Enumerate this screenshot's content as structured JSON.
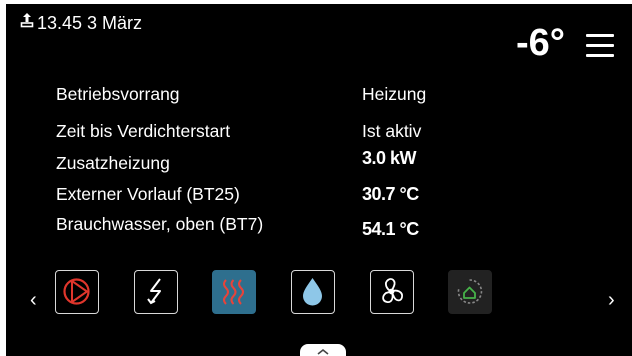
{
  "status": {
    "text": "13.45 3 März",
    "icon": "upload-icon"
  },
  "header": {
    "temperature": "-6°",
    "menu_icon": "hamburger-menu-icon"
  },
  "info_rows": [
    {
      "label": "Betriebsvorrang",
      "value": "Heizung"
    },
    {
      "label": "Zeit bis Verdichterstart",
      "value": "Ist aktiv"
    },
    {
      "label": "Zusatzheizung",
      "value": "3.0 kW"
    },
    {
      "label": "Externer Vorlauf (BT25)",
      "value": "30.7 °C"
    },
    {
      "label": "Brauchwasser, oben (BT7)",
      "value": "54.1 °C"
    }
  ],
  "carousel": {
    "prev_icon": "chevron-left-icon",
    "next_icon": "chevron-right-icon",
    "tiles": [
      {
        "icon": "compressor-icon",
        "state": "normal"
      },
      {
        "icon": "electric-heater-icon",
        "state": "normal"
      },
      {
        "icon": "heating-icon",
        "state": "active"
      },
      {
        "icon": "hot-water-icon",
        "state": "normal"
      },
      {
        "icon": "fan-icon",
        "state": "normal"
      },
      {
        "icon": "house-cycle-icon",
        "state": "disabled"
      }
    ]
  },
  "colors": {
    "background": "#000000",
    "active_tile": "#2e6f8e",
    "compressor_red": "#e0362c",
    "heating_red": "#e8433a",
    "water_blue": "#8ec7e8",
    "house_green": "#47b34a"
  },
  "pull_tab_icon": "chevron-up-icon"
}
